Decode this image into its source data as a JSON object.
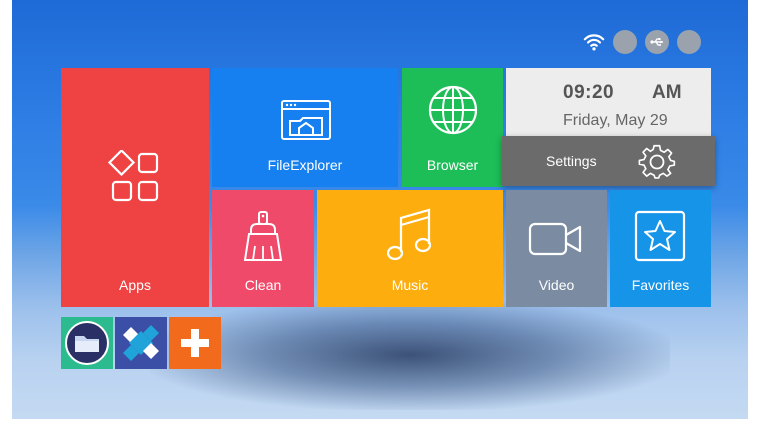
{
  "status_bar": {
    "icons": [
      "wifi-icon",
      "status-dot-icon",
      "usb-icon",
      "status-dot-icon"
    ]
  },
  "tiles": {
    "apps": {
      "label": "Apps",
      "icon": "apps-grid-icon",
      "color": "#ef4343"
    },
    "file_explorer": {
      "label": "FileExplorer",
      "icon": "file-explorer-icon",
      "color": "#1680f0"
    },
    "browser": {
      "label": "Browser",
      "icon": "globe-icon",
      "color": "#1dbd57"
    },
    "clean": {
      "label": "Clean",
      "icon": "broom-icon",
      "color": "#ef4a6a"
    },
    "music": {
      "label": "Music",
      "icon": "music-note-icon",
      "color": "#fdae0e"
    },
    "video": {
      "label": "Video",
      "icon": "video-camera-icon",
      "color": "#7b8ca2"
    },
    "favorites": {
      "label": "Favorites",
      "icon": "star-icon",
      "color": "#1694e8"
    }
  },
  "clock": {
    "time": "09:20",
    "ampm": "AM",
    "date": "Friday, May 29"
  },
  "settings": {
    "label": "Settings",
    "icon": "gear-icon"
  },
  "shortcuts": [
    "folder-app-icon",
    "kodi-icon",
    "plus-app-icon"
  ]
}
